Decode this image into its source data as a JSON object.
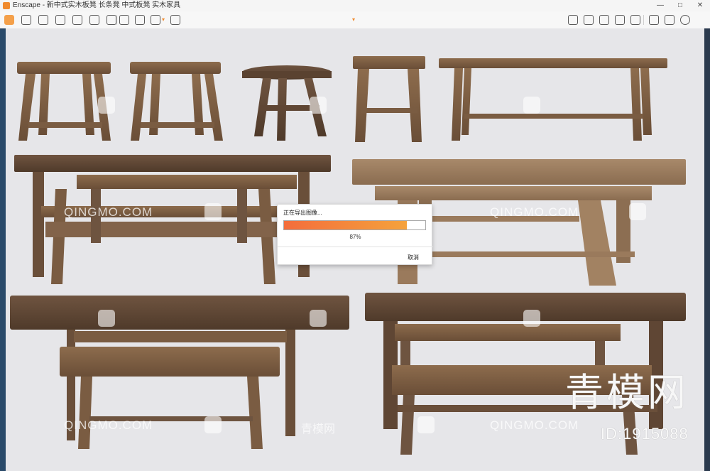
{
  "window": {
    "title": "Enscape - 新中式实木板凳 长条凳 中式板凳 实木家具",
    "controls": [
      "—",
      "□",
      "✕"
    ]
  },
  "toolbar": {
    "icons": [
      "enscape-logo-icon",
      "link-icon",
      "pin-icon",
      "binoculars-icon",
      "sync-icon",
      "upload-icon",
      "building-icon",
      "clapper-icon",
      "screenshot-icon",
      "batch-render-icon",
      "export-icon",
      "video-icon",
      "map-icon",
      "panorama-icon",
      "cube-icon",
      "asset-icon",
      "settings-sliders-icon",
      "eye-icon",
      "gear-icon",
      "help-icon"
    ],
    "accent": "#f08a2d"
  },
  "dialog": {
    "title": "正在导出图像...",
    "progress": 0.87,
    "percent_label": "87%",
    "cancel_label": "取消",
    "bar_start": "#f36d3c",
    "bar_end": "#f5a23c"
  },
  "watermarks": {
    "latin": "QINGMO.COM",
    "cn": "青模网",
    "big_cn": "青模网",
    "big_id": "ID:1915088"
  },
  "colors": {
    "background": "#e6e6e9",
    "wood_light": "#8a6a4a",
    "wood_dark": "#5f4632"
  }
}
